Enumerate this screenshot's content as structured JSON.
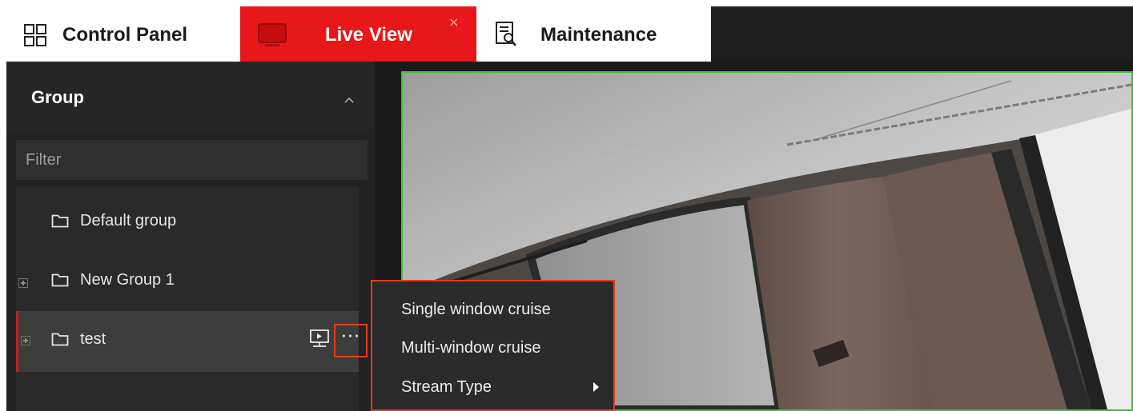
{
  "tabs": {
    "control_panel": "Control Panel",
    "live_view": "Live View",
    "live_view_close": "×",
    "maintenance": "Maintenance"
  },
  "sidebar": {
    "group_title": "Group",
    "filter_placeholder": "Filter",
    "groups": [
      {
        "label": "Default group"
      },
      {
        "label": "New Group 1"
      },
      {
        "label": "test"
      }
    ],
    "more_label": "···"
  },
  "context_menu": {
    "items": [
      {
        "label": "Single window cruise"
      },
      {
        "label": "Multi-window cruise"
      },
      {
        "label": "Stream Type"
      }
    ]
  },
  "colors": {
    "accent_red": "#e8171a",
    "highlight_border": "#e33b1a",
    "active_window_border": "#2fc932"
  },
  "icons": {
    "control_panel": "grid-icon",
    "live_view": "monitor-icon",
    "maintenance": "report-search-icon",
    "group_collapse": "chevron-up-icon",
    "folder": "folder-icon",
    "expand": "plus-box-icon",
    "play": "play-window-icon",
    "submenu": "caret-right-icon"
  }
}
